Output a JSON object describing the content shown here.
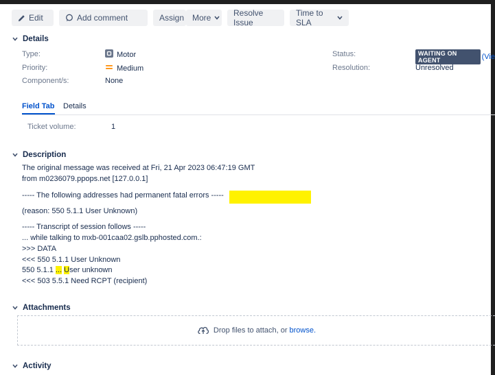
{
  "toolbar": {
    "edit": "Edit",
    "add_comment": "Add comment",
    "assign": "Assign",
    "more": "More",
    "resolve": "Resolve Issue",
    "sla": "Time to SLA"
  },
  "details": {
    "title": "Details",
    "type_label": "Type:",
    "type_value": "Motor",
    "priority_label": "Priority:",
    "priority_value": "Medium",
    "component_label": "Component/s:",
    "component_value": "None",
    "status_label": "Status:",
    "status_value": "WAITING ON AGENT",
    "status_link": "(Vie",
    "resolution_label": "Resolution:",
    "resolution_value": "Unresolved",
    "priority_color": "#ff8b00"
  },
  "tabs": {
    "field_tab": "Field Tab",
    "details_tab": "Details"
  },
  "field": {
    "ticket_volume_label": "Ticket volume:",
    "ticket_volume_value": "1"
  },
  "description": {
    "title": "Description",
    "line1": "The original message was received at Fri, 21 Apr 2023 06:47:19 GMT",
    "line2": "from m0236079.ppops.net [127.0.0.1]",
    "line3": "----- The following addresses had permanent fatal errors -----",
    "line4": "(reason: 550 5.1.1 User Unknown)",
    "line5": "----- Transcript of session follows -----",
    "line6": "... while talking to mxb-001caa02.gslb.pphosted.com.:",
    "line7": ">>> DATA",
    "line8": "<<< 550 5.1.1 User Unknown",
    "line9_a": "550 5.1.1 ",
    "line9_b": "...",
    "line9_c": " ",
    "line9_d": "U",
    "line9_e": "ser unknown",
    "line10": "<<< 503 5.5.1 Need RCPT (recipient)"
  },
  "attachments": {
    "title": "Attachments",
    "drop_text": "Drop files to attach, or",
    "browse": "browse."
  },
  "activity": {
    "title": "Activity"
  }
}
